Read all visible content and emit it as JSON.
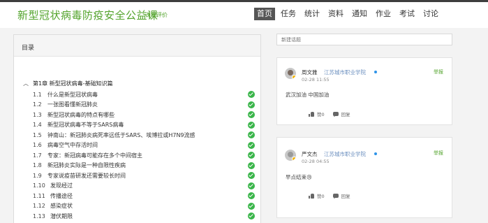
{
  "header": {
    "course_title": "新型冠状病毒防疫安全公益课",
    "course_eval": "课程评价",
    "nav": [
      "首页",
      "任务",
      "统计",
      "资料",
      "通知",
      "作业",
      "考试",
      "讨论"
    ],
    "active_nav": "首页"
  },
  "catalog": {
    "title": "目录",
    "chapter": "第1章 新型冠状病毒-基础知识篇",
    "lessons": [
      {
        "num": "1.1",
        "title": "什么是新型冠状病毒",
        "done": true
      },
      {
        "num": "1.2",
        "title": "一张图看懂新冠肺炎",
        "done": true
      },
      {
        "num": "1.3",
        "title": "新型冠状病毒的特点有哪些",
        "done": true
      },
      {
        "num": "1.4",
        "title": "新型冠状病毒不等于SARS病毒",
        "done": true
      },
      {
        "num": "1.5",
        "title": "钟南山：新冠肺炎病死率远低于SARS、埃博拉或H7N9流感",
        "done": true
      },
      {
        "num": "1.6",
        "title": "病毒空气中存活时间",
        "done": true
      },
      {
        "num": "1.7",
        "title": "专家：新冠病毒可能存在多个中间宿主",
        "done": true
      },
      {
        "num": "1.8",
        "title": "新冠肺炎实际是一种自限性疾病",
        "done": true
      },
      {
        "num": "1.9",
        "title": "专家说疫苗研发还需要较长时间",
        "done": true
      },
      {
        "num": "1.10",
        "title": "发现经过",
        "done": true
      },
      {
        "num": "1.11",
        "title": "传播途径",
        "done": true
      },
      {
        "num": "1.12",
        "title": "感染症状",
        "done": true
      },
      {
        "num": "1.13",
        "title": "潜伏期限",
        "done": true
      }
    ]
  },
  "discussion": {
    "new_topic_placeholder": "新建话题",
    "posts": [
      {
        "user": "周文雅",
        "school": "江苏城市职业学院",
        "time": "02-28 11:55",
        "content": "武汉加油 中国加油",
        "report": "举报",
        "like": "赞0",
        "reply": "回复"
      },
      {
        "user": "严文杰",
        "school": "江苏城市职业学院",
        "time": "02-28 04:55",
        "content": "早点结束😢",
        "report": "举报",
        "like": "赞0",
        "reply": "回复"
      }
    ]
  },
  "colors": {
    "accent": "#52a32b",
    "check": "#3ab54a",
    "school": "#6b8fbf",
    "online_dot": "#2e93e8"
  }
}
